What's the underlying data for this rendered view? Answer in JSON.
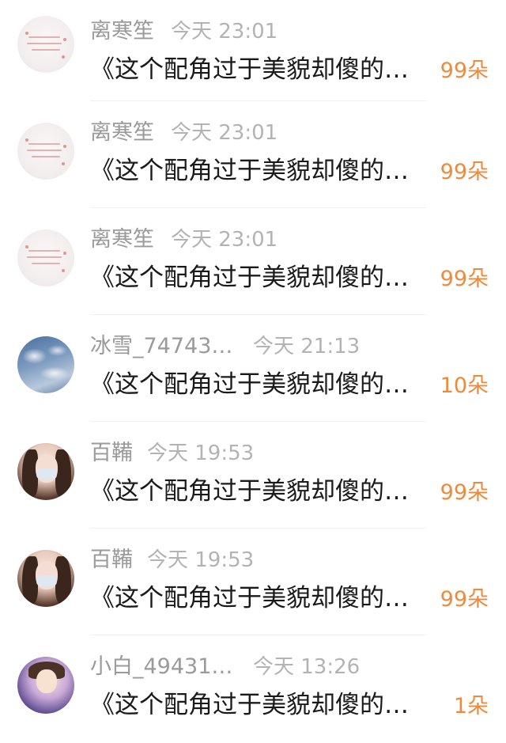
{
  "messages": [
    {
      "username": "离寒笙",
      "time": "今天 23:01",
      "text": "《这个配角过于美貌却傻的…",
      "count": "99朵",
      "avatar": "paper-sketch"
    },
    {
      "username": "离寒笙",
      "time": "今天 23:01",
      "text": "《这个配角过于美貌却傻的…",
      "count": "99朵",
      "avatar": "paper-sketch"
    },
    {
      "username": "离寒笙",
      "time": "今天 23:01",
      "text": "《这个配角过于美貌却傻的…",
      "count": "99朵",
      "avatar": "paper-sketch"
    },
    {
      "username": "冰雪_74743…",
      "time": "今天 21:13",
      "text": "《这个配角过于美貌却傻的…",
      "count": "10朵",
      "avatar": "sky-clouds"
    },
    {
      "username": "百鞴",
      "time": "今天 19:53",
      "text": "《这个配角过于美貌却傻的…",
      "count": "99朵",
      "avatar": "girl-mask"
    },
    {
      "username": "百鞴",
      "time": "今天 19:53",
      "text": "《这个配角过于美貌却傻的…",
      "count": "99朵",
      "avatar": "girl-mask"
    },
    {
      "username": "小白_49431…",
      "time": "今天 13:26",
      "text": "《这个配角过于美貌却傻的…",
      "count": "1朵",
      "avatar": "anime-girl"
    }
  ],
  "colors": {
    "count_orange": "#ee8a3c",
    "username_gray": "#9a9a9a",
    "time_gray": "#b3b3b3",
    "text_dark": "#1a1a1a"
  }
}
